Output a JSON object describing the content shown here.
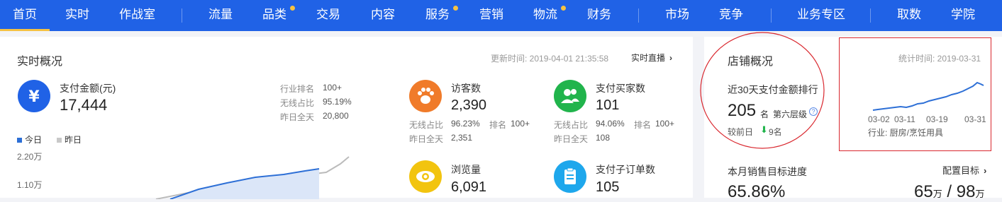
{
  "nav": {
    "items": [
      {
        "label": "首页",
        "active": true
      },
      {
        "label": "实时"
      },
      {
        "label": "作战室"
      },
      {
        "label": "流量"
      },
      {
        "label": "品类",
        "dot": true
      },
      {
        "label": "交易"
      },
      {
        "label": "内容"
      },
      {
        "label": "服务",
        "dot": true
      },
      {
        "label": "营销"
      },
      {
        "label": "物流",
        "dot": true
      },
      {
        "label": "财务"
      },
      {
        "label": "市场"
      },
      {
        "label": "竞争"
      },
      {
        "label": "业务专区"
      },
      {
        "label": "取数"
      },
      {
        "label": "学院"
      }
    ]
  },
  "realtime": {
    "title": "实时概况",
    "update_time": "更新时间: 2019-04-01 21:35:58",
    "live_link": "实时直播",
    "payment": {
      "label": "支付金额(元)",
      "value": "17,444",
      "icon": "yuan-icon",
      "rank_label": "行业排名",
      "rank_value": "100+",
      "wireless_label": "无线占比",
      "wireless_value": "95.19%",
      "yesterday_label": "昨日全天",
      "yesterday_value": "20,800"
    },
    "legend": {
      "today": "今日",
      "yesterday": "昨日"
    },
    "y_ticks": [
      "2.20万",
      "1.10万"
    ],
    "visitors": {
      "label": "访客数",
      "value": "2,390",
      "icon": "paw-icon",
      "wireless_label": "无线占比",
      "wireless_value": "96.23%",
      "rank_label": "排名",
      "rank_value": "100+",
      "yesterday_label": "昨日全天",
      "yesterday_value": "2,351"
    },
    "buyers": {
      "label": "支付买家数",
      "value": "101",
      "icon": "users-icon",
      "wireless_label": "无线占比",
      "wireless_value": "94.06%",
      "rank_label": "排名",
      "rank_value": "100+",
      "yesterday_label": "昨日全天",
      "yesterday_value": "108"
    },
    "pageviews": {
      "label": "浏览量",
      "value": "6,091",
      "icon": "eye-icon"
    },
    "suborders": {
      "label": "支付子订单数",
      "value": "105",
      "icon": "clipboard-icon"
    }
  },
  "store": {
    "title": "店铺概况",
    "rank_title": "近30天支付金额排行",
    "rank_value": "205",
    "rank_unit": "名",
    "tier": "第六层级",
    "prev_label": "较前日",
    "prev_change": "9名",
    "stat_time": "统计时间: 2019-03-31",
    "x_labels": [
      "03-02",
      "03-11",
      "03-19",
      "03-31"
    ],
    "industry": "行业: 厨房/烹饪用具",
    "target_title": "本月销售目标进度",
    "target_link": "配置目标",
    "progress": "65.86%",
    "amount_current": "65",
    "amount_unit1": "万",
    "amount_sep": "/",
    "amount_total": "98",
    "amount_unit2": "万"
  },
  "colors": {
    "nav": "#2062e6",
    "accent_yellow": "#f5c242",
    "line_blue": "#2d6fd6",
    "annotation_red": "#d9272e",
    "orange": "#f07b2a",
    "green": "#21b44c",
    "cyan": "#1ea7ec",
    "yellow_icon": "#f2c40f"
  }
}
